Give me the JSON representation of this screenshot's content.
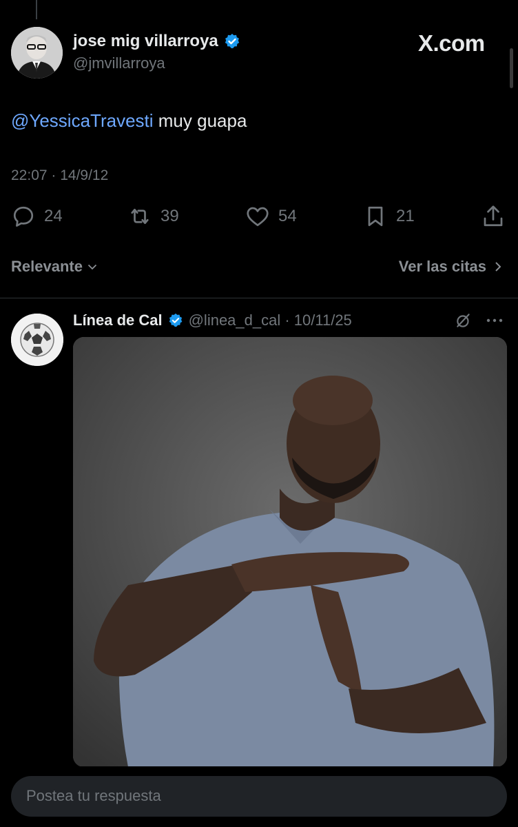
{
  "tweet": {
    "author_name": "jose mig villarroya",
    "author_handle": "@jmvillarroya",
    "brand": "X.com",
    "mention": "@YessicaTravesti",
    "text": " muy guapa",
    "timestamp": "22:07 · 14/9/12",
    "stats": {
      "replies": "24",
      "retweets": "39",
      "likes": "54",
      "bookmarks": "21"
    }
  },
  "sort": {
    "label": "Relevante",
    "quotes_label": "Ver las citas"
  },
  "reply": {
    "author_name": "Línea de Cal",
    "meta": "@linea_d_cal · 10/11/25"
  },
  "compose": {
    "placeholder": "Postea tu respuesta"
  },
  "colors": {
    "background": "#000000",
    "verified": "#1d9bf0",
    "mention": "#6ea8fe",
    "muted": "#71767b"
  }
}
